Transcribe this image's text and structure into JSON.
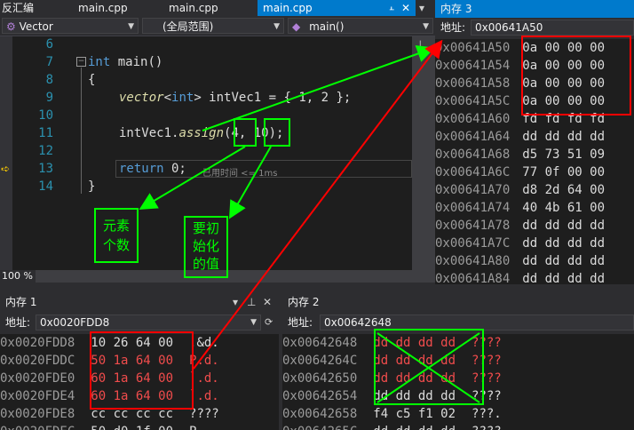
{
  "tabs": {
    "disasm": "反汇编",
    "file1": "main.cpp",
    "file2": "main.cpp",
    "file3": "main.cpp",
    "dropdown": "▾"
  },
  "navbar": {
    "scope1": "Vector",
    "scope2": "(全局范围)",
    "scope3": "main()"
  },
  "code": {
    "line6": "6",
    "line7": "7",
    "line8": "8",
    "line9": "9",
    "line10": "10",
    "line11": "11",
    "line12": "12",
    "line13": "13",
    "line14": "14",
    "l7_int": "int",
    "l7_main": " main()",
    "l8": "{",
    "l9_vector": "vector",
    "l9_lt": "<",
    "l9_int": "int",
    "l9_rest": "> intVec1 = { 1, 2 };",
    "l11_a": "intVec1.",
    "l11_assign": "assign",
    "l11_b": "(",
    "l11_4": "4",
    "l11_c": ", ",
    "l11_10": "10",
    "l11_d": ");",
    "l13_return": "return",
    "l13_zero": " 0;",
    "l13_hint": "已用时间 <= 1ms",
    "l14": "}"
  },
  "zoom": "100 %",
  "annotations": {
    "count": [
      "元素",
      "个数"
    ],
    "init": [
      "要初",
      "始化",
      "的值"
    ]
  },
  "mem3": {
    "title": "内存 3",
    "addr_label": "地址:",
    "addr_value": "0x00641A50",
    "rows": [
      {
        "addr": "0x00641A50",
        "bytes": "0a 00 00 00"
      },
      {
        "addr": "0x00641A54",
        "bytes": "0a 00 00 00"
      },
      {
        "addr": "0x00641A58",
        "bytes": "0a 00 00 00"
      },
      {
        "addr": "0x00641A5C",
        "bytes": "0a 00 00 00"
      },
      {
        "addr": "0x00641A60",
        "bytes": "fd fd fd fd"
      },
      {
        "addr": "0x00641A64",
        "bytes": "dd dd dd dd"
      },
      {
        "addr": "0x00641A68",
        "bytes": "d5 73 51 09"
      },
      {
        "addr": "0x00641A6C",
        "bytes": "77 0f 00 00"
      },
      {
        "addr": "0x00641A70",
        "bytes": "d8 2d 64 00"
      },
      {
        "addr": "0x00641A74",
        "bytes": "40 4b 61 00"
      },
      {
        "addr": "0x00641A78",
        "bytes": "dd dd dd dd"
      },
      {
        "addr": "0x00641A7C",
        "bytes": "dd dd dd dd"
      },
      {
        "addr": "0x00641A80",
        "bytes": "dd dd dd dd"
      },
      {
        "addr": "0x00641A84",
        "bytes": "dd dd dd dd"
      }
    ]
  },
  "mem1": {
    "title": "内存 1",
    "addr_label": "地址:",
    "addr_value": "0x0020FDD8",
    "rows": [
      {
        "addr": "0x0020FDD8",
        "bytes": "10 26 64 00",
        "ascii": ".&d."
      },
      {
        "addr": "0x0020FDDC",
        "bytes": "50 1a 64 00",
        "ascii": "P.d."
      },
      {
        "addr": "0x0020FDE0",
        "bytes": "60 1a 64 00",
        "ascii": "`.d."
      },
      {
        "addr": "0x0020FDE4",
        "bytes": "60 1a 64 00",
        "ascii": "`.d."
      },
      {
        "addr": "0x0020FDE8",
        "bytes": "cc cc cc cc",
        "ascii": "????"
      },
      {
        "addr": "0x0020FDEC",
        "bytes": "50 d0 1f 00",
        "ascii": "P..."
      }
    ]
  },
  "mem2": {
    "title": "内存 2",
    "addr_label": "地址:",
    "addr_value": "0x00642648",
    "rows": [
      {
        "addr": "0x00642648",
        "bytes": "dd dd dd dd",
        "ascii": "????"
      },
      {
        "addr": "0x0064264C",
        "bytes": "dd dd dd dd",
        "ascii": "????"
      },
      {
        "addr": "0x00642650",
        "bytes": "dd dd dd dd",
        "ascii": "????"
      },
      {
        "addr": "0x00642654",
        "bytes": "dd dd dd dd",
        "ascii": "????"
      },
      {
        "addr": "0x00642658",
        "bytes": "f4 c5 f1 02",
        "ascii": "???."
      },
      {
        "addr": "0x0064265C",
        "bytes": "dd dd dd dd",
        "ascii": "????"
      }
    ]
  },
  "icons": {
    "pin": "pin-icon",
    "close": "close-icon",
    "dropdown": "chevron-down-icon",
    "breakpoint_arrow": "current-statement-arrow-icon"
  },
  "colors": {
    "accent": "#007acc",
    "annotation_green": "#00ff00",
    "annotation_red": "#ff0000"
  }
}
